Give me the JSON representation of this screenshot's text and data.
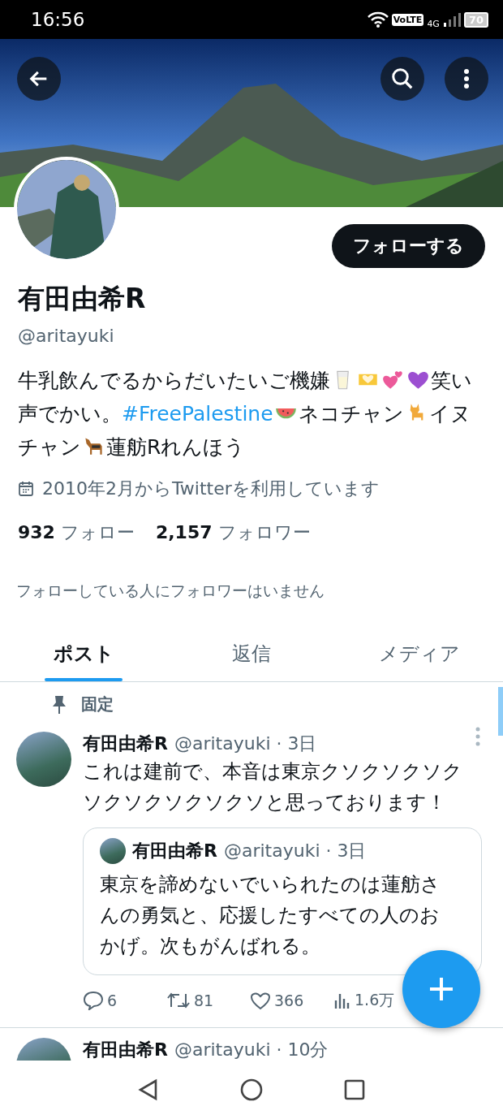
{
  "status_bar": {
    "time": "16:56",
    "volte": "VoLTE",
    "network": "4G",
    "battery": "70"
  },
  "profile": {
    "name": "有田由希R",
    "handle": "@aritayuki",
    "follow_button": "フォローする",
    "bio": [
      {
        "kind": "text",
        "text": "牛乳飲んでるからだいたいご機嫌"
      },
      {
        "kind": "milk"
      },
      {
        "kind": "hands"
      },
      {
        "kind": "hearts"
      },
      {
        "kind": "heart"
      },
      {
        "kind": "text",
        "text": "笑い"
      },
      {
        "kind": "text",
        "text": "声でかい。"
      },
      {
        "kind": "hashtag",
        "text": "#FreePalestine"
      },
      {
        "kind": "watermelon"
      },
      {
        "kind": "text",
        "text": "ネコチャン"
      },
      {
        "kind": "cat"
      },
      {
        "kind": "text",
        "text": "イヌ"
      },
      {
        "kind": "text",
        "text": "チャン"
      },
      {
        "kind": "dog"
      },
      {
        "kind": "text",
        "text": "蓮舫Rれんほう"
      }
    ],
    "joined": "2010年2月からTwitterを利用しています",
    "following_count": "932",
    "following_label": "フォロー",
    "followers_count": "2,157",
    "followers_label": "フォロワー",
    "followers_you_know": "フォローしている人にフォロワーはいません"
  },
  "tabs": [
    {
      "label": "ポスト",
      "selected": true
    },
    {
      "label": "返信",
      "selected": false
    },
    {
      "label": "メディア",
      "selected": false
    }
  ],
  "posts": [
    {
      "pinned_label": "固定",
      "name": "有田由希R",
      "meta": "@aritayuki · 3日",
      "text": "これは建前で、本音は東京クソクソクソクソクソクソクソクソと思っております！",
      "quote": {
        "name": "有田由希R",
        "meta": "@aritayuki · 3日",
        "text": "東京を諦めないでいられたのは蓮舫さんの勇気と、応援したすべての人のおかげ。次もがんばれる。"
      },
      "replies": "6",
      "reposts": "81",
      "likes": "366",
      "views": "1.6万"
    },
    {
      "name": "有田由希R",
      "meta": "@aritayuki · 10分"
    }
  ]
}
